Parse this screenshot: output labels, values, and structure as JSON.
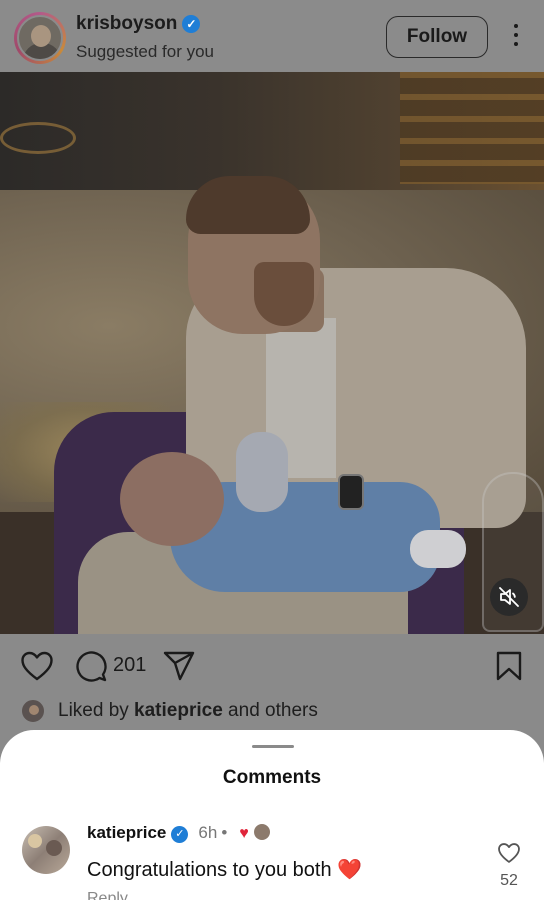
{
  "header": {
    "username": "krisboyson",
    "subtitle": "Suggested for you",
    "follow_label": "Follow"
  },
  "post": {
    "comment_count": "201",
    "liked_prefix": "Liked by ",
    "liked_user": "katieprice",
    "liked_suffix": " and others"
  },
  "comments_sheet": {
    "title": "Comments",
    "comments": [
      {
        "username": "katieprice",
        "time": "6h",
        "text": "Congratulations to you both",
        "text_emoji": "❤️",
        "reply_label": "Reply",
        "like_count": "52"
      }
    ]
  },
  "icons": {
    "verified": "verified-badge-icon",
    "like": "heart-outline-icon",
    "comment": "speech-bubble-icon",
    "share": "paper-plane-icon",
    "save": "bookmark-icon",
    "more": "vertical-ellipsis-icon",
    "mute": "speaker-muted-icon"
  },
  "colors": {
    "verified": "#1f7ed6",
    "heart": "#e0243a",
    "dim_overlay": "#8a8a8a"
  }
}
